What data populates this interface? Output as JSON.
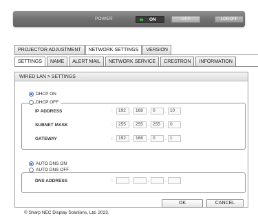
{
  "top_bar": {
    "power_label": "POWER",
    "on_label": "ON",
    "off_label": "OFF",
    "logoff_label": "LOGOFF"
  },
  "main_tabs": [
    {
      "label": "PROJECTOR ADJUSTMENT",
      "active": false
    },
    {
      "label": "NETWORK SETTINGS",
      "active": true
    },
    {
      "label": "VERSION",
      "active": false
    }
  ],
  "sub_tabs": [
    {
      "label": "SETTINGS",
      "active": true
    },
    {
      "label": "NAME",
      "active": false
    },
    {
      "label": "ALERT MAIL",
      "active": false
    },
    {
      "label": "NETWORK SERVICE",
      "active": false
    },
    {
      "label": "CRESTRON",
      "active": false
    },
    {
      "label": "INFORMATION",
      "active": false
    }
  ],
  "panel": {
    "title": "WIRED LAN > SETTINGS",
    "dhcp_on_label": "DHCP ON",
    "dhcp_off_label": "DHCP OFF",
    "dhcp_selected": "DHCP ON",
    "fields": {
      "ip": {
        "label": "IP ADDRESS",
        "octets": [
          "192",
          "168",
          "0",
          "10"
        ]
      },
      "subnet": {
        "label": "SUBNET MASK",
        "octets": [
          "255",
          "255",
          "255",
          "0"
        ]
      },
      "gateway": {
        "label": "GATEWAY",
        "octets": [
          "192",
          "168",
          "0",
          "1"
        ]
      }
    },
    "auto_dns_on_label": "AUTO DNS ON",
    "auto_dns_off_label": "AUTO DNS OFF",
    "auto_dns_selected": "AUTO DNS ON",
    "dns": {
      "label": "DNS ADDRESS",
      "octets": [
        "",
        "",
        "",
        ""
      ]
    },
    "ok_label": "OK",
    "cancel_label": "CANCEL"
  },
  "footer": {
    "copyright": "© Sharp NEC Display Solutions, Ltd. 2023."
  }
}
